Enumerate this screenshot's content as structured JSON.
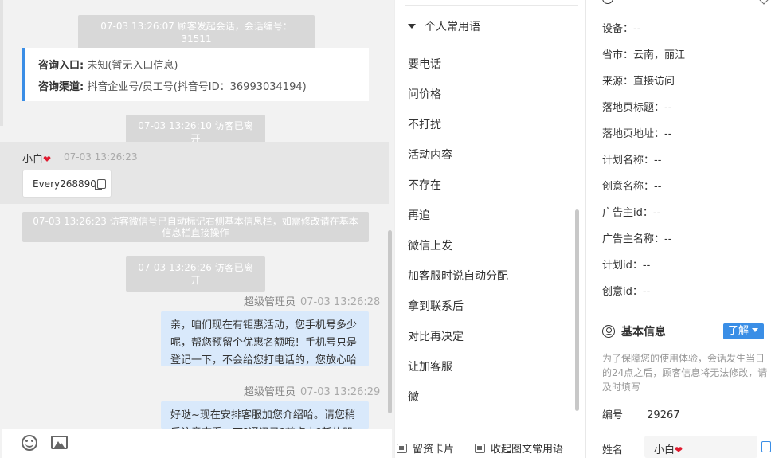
{
  "chat": {
    "system_session_start": "07-03 13:26:07 顾客发起会话，会话编号：31511",
    "entry_label": "咨询入口:",
    "entry_value": "未知(暂无入口信息)",
    "channel_label": "咨询渠道:",
    "channel_value": "抖音企业号/员工号(抖音号ID：36993034194)",
    "system_visitor_left_1": "07-03 13:26:10 访客已离开",
    "visitor_name": "小白",
    "visitor_heart": "❤",
    "visitor_msg_time": "07-03 13:26:23",
    "wechat_card_text": "Every268890",
    "system_wechat_note": "07-03 13:26:23 访客微信号已自动标记右侧基本信息栏，如需修改请在基本信息栏直接操作",
    "system_visitor_left_2": "07-03 13:26:26 访客已离开",
    "agent_name": "超级管理员",
    "agent_msg1_time": "07-03 13:26:28",
    "agent_msg1_text": "亲，咱们现在有钜惠活动，您手机号多少呢，帮您预留个优惠名额哦！手机号只是登记一下，不会给您打电话的，您放心哈",
    "agent_msg2_time": "07-03 13:26:29",
    "agent_msg2_text": "好哒~现在安排客服加您介绍哈。请您稍后注意查看，下?通讯录?首点击?新的朋友"
  },
  "phrases": {
    "header": "个人常用语",
    "items": [
      "要电话",
      "问价格",
      "不打扰",
      "活动内容",
      "不存在",
      "再追",
      "微信上发",
      "加客服时说自动分配",
      "拿到联系后",
      "对比再决定",
      "让加客服",
      "微"
    ],
    "leave_card_label": "留资卡片",
    "collapse_label": "收起图文常用语"
  },
  "info": {
    "rows": [
      {
        "label": "设备：",
        "value": "--"
      },
      {
        "label": "省市：",
        "value": "云南，丽江"
      },
      {
        "label": "来源：",
        "value": "直接访问"
      },
      {
        "label": "落地页标题：",
        "value": "--"
      },
      {
        "label": "落地页地址：",
        "value": "--"
      },
      {
        "label": "计划名称：",
        "value": "--"
      },
      {
        "label": "创意名称：",
        "value": "--"
      },
      {
        "label": "广告主id：",
        "value": "--"
      },
      {
        "label": "广告主名称：",
        "value": "--"
      },
      {
        "label": "计划id：",
        "value": "--"
      },
      {
        "label": "创意id：",
        "value": "--"
      }
    ],
    "basic_title": "基本信息",
    "learn_label": "了解",
    "notice": "为了保障您的使用体验，会话发生当日的24点之后，顾客信息将无法修改，请及时填写",
    "id_label": "编号",
    "id_value": "29267",
    "name_label": "姓名",
    "name_value": "小白",
    "name_heart": "❤"
  },
  "colors": {
    "accent": "#3a8ee6",
    "bubble": "#d9e9fb",
    "heart": "#e0192e"
  }
}
